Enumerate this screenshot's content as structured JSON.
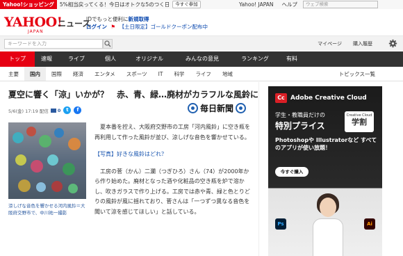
{
  "promo": {
    "brand": "Yahoo!ショッピング",
    "text": "5%相当戻ってくる！今日はオトクな5のつく日",
    "button": "今すぐ参加"
  },
  "toplinks": {
    "items": [
      "Yahoo! JAPAN",
      "ヘルプ"
    ],
    "search_placeholder": "ウェブ検索"
  },
  "header": {
    "logo": "YAHOO!",
    "logo_sub": "JAPAN",
    "section": "ニュース",
    "login_line1_text": "IDでもっと便利に",
    "login_line1_register": "新規取得",
    "login_line2_login": "ログイン",
    "login_line2_promo": "【土日限定】ゴールドクーポン配布中"
  },
  "searchbar": {
    "placeholder": "キーワードを入力",
    "links": [
      "マイページ",
      "購入履歴"
    ]
  },
  "nav": {
    "items": [
      "トップ",
      "速報",
      "ライブ",
      "個人",
      "オリジナル",
      "みんなの意見",
      "ランキング",
      "有料"
    ],
    "active": "トップ"
  },
  "subnav": {
    "items": [
      "主要",
      "国内",
      "国際",
      "経済",
      "エンタメ",
      "スポーツ",
      "IT",
      "科学",
      "ライフ",
      "地域"
    ],
    "active": "国内",
    "topics": "トピックス一覧"
  },
  "article": {
    "headline": "夏空に響く「涼」いかが？　赤、青、緑…廃材がカラフルな風鈴に",
    "meta": "5/6(金) 17:19 配信",
    "comment_count": "0",
    "publisher": "毎日新聞",
    "caption": "涼しげな音色を響かせる河内風鈴＝大阪府交野市で、中川祐一撮影",
    "para1": "夏本番を控え、大阪府交野市の工房「河内風鈴」に空き瓶を再利用して作った風鈴が並び、涼しげな音色を響かせている。",
    "link": "【写真】好きな風鈴はどれ？",
    "para2": "工房の菅（かん）二瀾（つぎひろ）さん（74）が2000年から作り始めた。廃材となった酒や化粧品の空き瓶を炉で溶かし、吹きガラスで作り上げる。工房では赤や青、緑と色とりどりの風鈴が風に揺れており、菅さんは「一つずつ異なる音色を聞いて涼を感じてほしい」と話している。"
  },
  "ad": {
    "brand": "Adobe Creative Cloud",
    "line1": "学生・教職員だけの",
    "line2": "特別プライス",
    "badge_small": "Creative Cloud",
    "badge_big": "学割",
    "line3": "Photoshopや Illustratorなど すべてのアプリが使い放題！",
    "cta": "今すぐ購入"
  }
}
